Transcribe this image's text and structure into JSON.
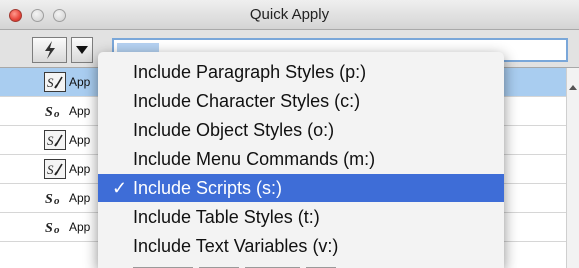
{
  "window": {
    "title": "Quick Apply"
  },
  "toolbar": {
    "bolt_icon": "lightning-bolt-icon",
    "dropdown_icon": "triangle-down-icon",
    "search_value": ""
  },
  "list": {
    "rows": [
      {
        "label": "App",
        "icon": "paragraph-style-icon",
        "selected": true
      },
      {
        "label": "App",
        "icon": "script-icon",
        "selected": false
      },
      {
        "label": "App",
        "icon": "paragraph-style-icon",
        "selected": false
      },
      {
        "label": "App",
        "icon": "paragraph-style-icon",
        "selected": false
      },
      {
        "label": "App",
        "icon": "script-icon",
        "selected": false
      },
      {
        "label": "App",
        "icon": "script-icon",
        "selected": false
      }
    ]
  },
  "menu": {
    "items": [
      {
        "label": "Include Paragraph Styles (p:)",
        "checked": false
      },
      {
        "label": "Include Character Styles (c:)",
        "checked": false
      },
      {
        "label": "Include Object Styles (o:)",
        "checked": false
      },
      {
        "label": "Include Menu Commands (m:)",
        "checked": false
      },
      {
        "label": "Include Scripts (s:)",
        "checked": true
      },
      {
        "label": "Include Table Styles (t:)",
        "checked": false
      },
      {
        "label": "Include Text Variables (v:)",
        "checked": false
      }
    ],
    "check_mark": "✓"
  },
  "colors": {
    "menu_highlight": "#3e6dd7",
    "row_selected": "#a9cdf0",
    "search_focus": "#7aa7d9"
  }
}
